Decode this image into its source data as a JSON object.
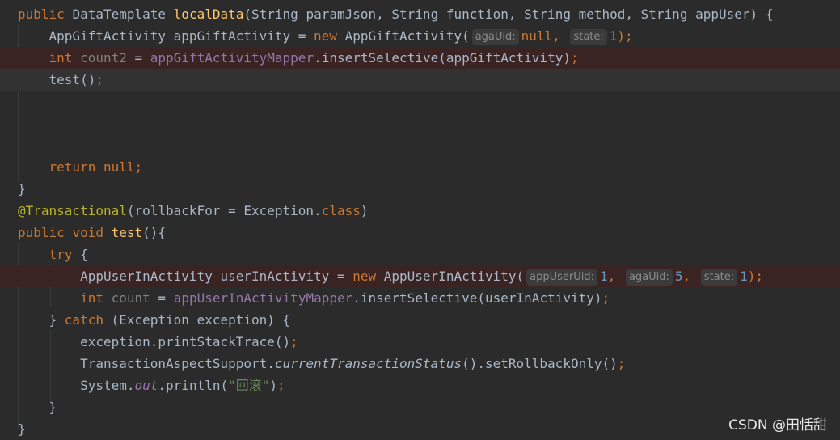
{
  "watermark": "CSDN @田恬甜",
  "code": {
    "l1": {
      "public": "public",
      "type": "DataTemplate",
      "name": "localData",
      "sig": "(String paramJson, String function, String method, String appUser) {"
    },
    "l2": {
      "pre": "AppGiftActivity appGiftActivity = ",
      "new": "new",
      "ctor": " AppGiftActivity(",
      "hint1": "agaUid:",
      "null": "null",
      "comma": ", ",
      "hint2": "state:",
      "num": "1",
      "end": ");"
    },
    "l3": {
      "int": "int",
      "var": "count2",
      "eq": " = ",
      "mapper": "appGiftActivityMapper",
      "call": ".insertSelective(appGiftActivity)",
      "semi": ";"
    },
    "l4": {
      "call": "test()",
      "semi": ";"
    },
    "l5": {
      "ret": "return",
      "null": "null",
      "semi": ";"
    },
    "l6": {
      "brace": "}"
    },
    "l7": {
      "ann": "@Transactional",
      "rest": "(rollbackFor = Exception.",
      "cls": "class",
      "close": ")"
    },
    "l8": {
      "public": "public",
      "void": "void",
      "name": "test",
      "rest": "(){"
    },
    "l9": {
      "try": "try",
      "rest": " {"
    },
    "l10": {
      "pre": "AppUserInActivity userInActivity = ",
      "new": "new",
      "ctor": " AppUserInActivity(",
      "hint1": "appUserUid:",
      "n1": "1",
      "c1": ", ",
      "hint2": "agaUid:",
      "n2": "5",
      "c2": ", ",
      "hint3": "state:",
      "n3": "1",
      "end": ");"
    },
    "l11": {
      "int": "int",
      "var": "count",
      "eq": " = ",
      "mapper": "appUserInActivityMapper",
      "call": ".insertSelective(userInActivity)",
      "semi": ";"
    },
    "l12": {
      "pre": "} ",
      "catch": "catch",
      "rest": " (Exception exception) {"
    },
    "l13": {
      "call": "exception.printStackTrace()",
      "semi": ";"
    },
    "l14": {
      "pre": "TransactionAspectSupport.",
      "it": "currentTransactionStatus",
      "rest": "().setRollbackOnly()",
      "semi": ";"
    },
    "l15": {
      "pre": "System.",
      "out": "out",
      "mid": ".println(",
      "str": "\"回滚\"",
      "end": ")",
      "semi": ";"
    },
    "l16": {
      "brace": "}"
    },
    "l17": {
      "brace": "}"
    }
  }
}
